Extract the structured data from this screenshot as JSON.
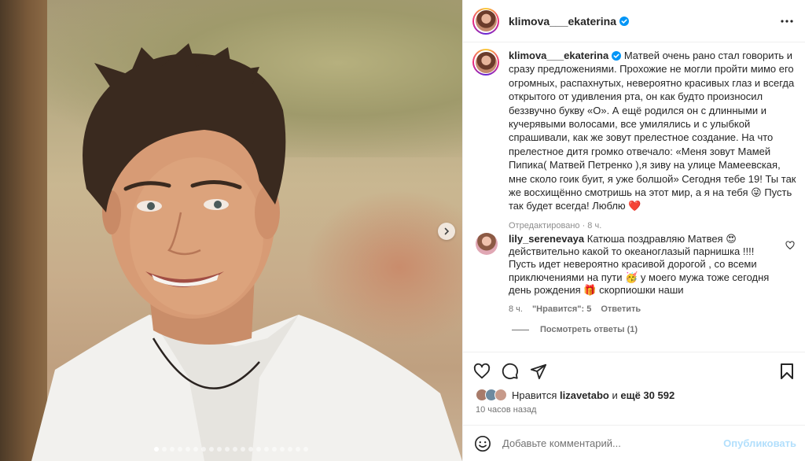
{
  "post": {
    "username": "klimova___ekaterina",
    "caption_line1": "Матвей очень рано стал говорить и",
    "caption_rest": "сразу предложениями. Прохожие не могли пройти мимо его огромных, распахнутых, невероятно красивых глаз и всегда открытого от удивления рта, он как будто произносил беззвучно букву «О». А ещё родился он с длинными и кучерявыми волосами, все умилялись и с улыбкой спрашивали, как же зовут прелестное создание. На что прелестное дитя громко отвечало: «Меня зовут Мамей Пипика( Матвей Петренко ),я зиву на улице Мамеевская, мне сколо гоик буит, я уже болшой» Сегодня тебе 19! Ты так же восхищённо смотришь на этот мир, а я на тебя",
    "caption_mid_emoji": "😜",
    "caption_tail": " Пусть так будет всегда! Люблю ",
    "caption_end_emoji": "❤️",
    "edited_label": "Отредактировано · 8 ч."
  },
  "comment": {
    "username": "lily_serenevaya",
    "text_a": "Катюша поздравляю Матвея ",
    "emoji_a": "😍",
    "text_b": " действительно какой то океаноглазый парнишка !!!! Пусть идет невероятно красивой дорогой , со всеми приключениями на пути ",
    "emoji_b": "🥳",
    "text_c": " у моего мужа тоже сегодня день рождения ",
    "emoji_c": "🎁",
    "text_d": " скорпиошки наши",
    "time": "8 ч.",
    "likes": "\"Нравится\": 5",
    "reply": "Ответить",
    "view_replies": "Посмотреть ответы (1)"
  },
  "likes": {
    "prefix": "Нравится",
    "user": "lizavetabo",
    "connector": "и",
    "count_text": "ещё 30 592"
  },
  "time_ago": "10 часов назад",
  "add_comment": {
    "placeholder": "Добавьте комментарий...",
    "publish": "Опубликовать"
  },
  "carousel": {
    "total": 20,
    "active_index": 0
  },
  "colors": {
    "accent": "#0095f6",
    "publish_disabled": "#b2dffc",
    "heart": "#ed4956"
  },
  "icons": [
    "verified-icon",
    "more-icon",
    "heart-icon",
    "comment-icon",
    "share-icon",
    "bookmark-icon",
    "emoji-icon",
    "chevron-right-icon"
  ]
}
